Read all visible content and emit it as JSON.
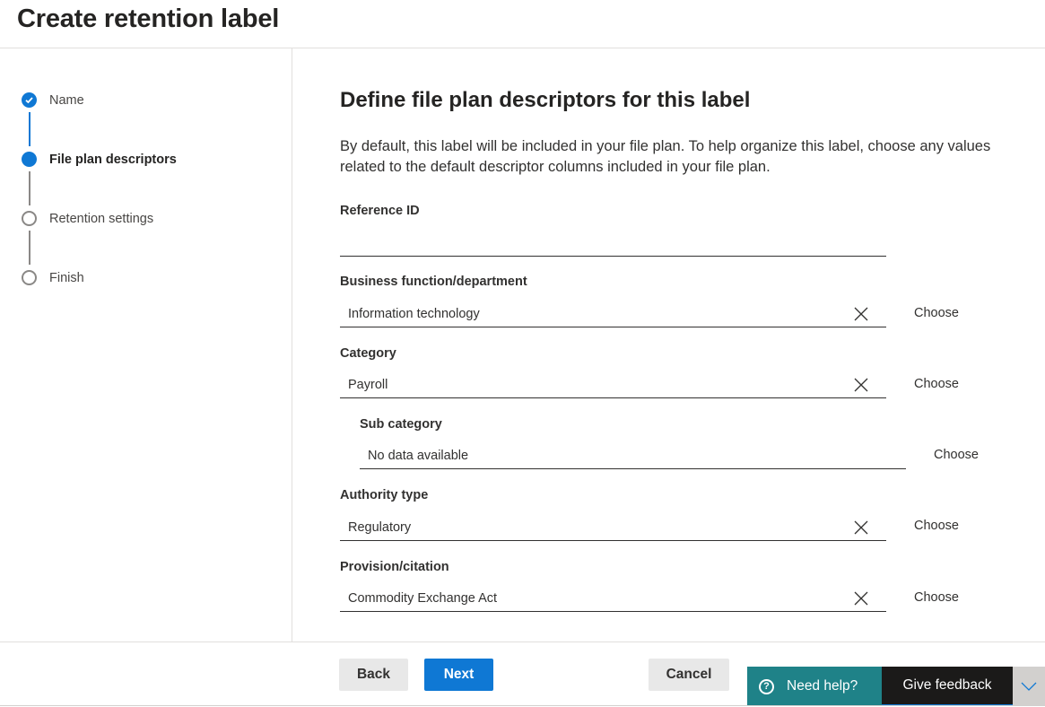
{
  "page": {
    "title": "Create retention label"
  },
  "stepper": {
    "steps": [
      {
        "label": "Name",
        "state": "completed"
      },
      {
        "label": "File plan descriptors",
        "state": "current"
      },
      {
        "label": "Retention settings",
        "state": "upcoming"
      },
      {
        "label": "Finish",
        "state": "upcoming"
      }
    ]
  },
  "content": {
    "title": "Define file plan descriptors for this label",
    "description": "By default, this label will be included in your file plan. To help organize this label, choose any values related to the default descriptor columns included in your file plan.",
    "fields": {
      "reference_id": {
        "label": "Reference ID",
        "value": ""
      },
      "business_function": {
        "label": "Business function/department",
        "value": "Information technology",
        "choose_label": "Choose"
      },
      "category": {
        "label": "Category",
        "value": "Payroll",
        "choose_label": "Choose"
      },
      "sub_category": {
        "label": "Sub category",
        "value": "No data available",
        "choose_label": "Choose"
      },
      "authority_type": {
        "label": "Authority type",
        "value": "Regulatory",
        "choose_label": "Choose"
      },
      "provision_citation": {
        "label": "Provision/citation",
        "value": "Commodity Exchange Act",
        "choose_label": "Choose"
      }
    }
  },
  "footer": {
    "back_label": "Back",
    "next_label": "Next",
    "cancel_label": "Cancel",
    "help_label": "Need help?",
    "help_icon_glyph": "?",
    "feedback_label": "Give feedback"
  },
  "colors": {
    "accent": "#0f78d4",
    "help_teal": "#1f8288",
    "feedback_dark": "#1b1a19"
  }
}
